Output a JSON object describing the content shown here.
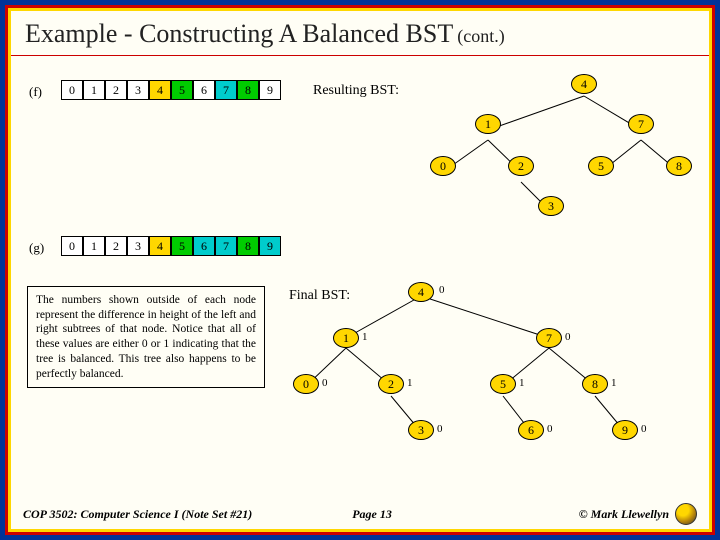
{
  "title": "Example - Constructing A Balanced BST",
  "title_cont": "(cont.)",
  "rows": {
    "f": {
      "label": "(f)",
      "cells": [
        "0",
        "1",
        "2",
        "3",
        "4",
        "5",
        "6",
        "7",
        "8",
        "9"
      ],
      "resulting_label": "Resulting BST:"
    },
    "g": {
      "label": "(g)",
      "cells": [
        "0",
        "1",
        "2",
        "3",
        "4",
        "5",
        "6",
        "7",
        "8",
        "9"
      ],
      "final_label": "Final BST:"
    }
  },
  "tree_f": {
    "n4": "4",
    "n1": "1",
    "n7": "7",
    "n0": "0",
    "n2": "2",
    "n5": "5",
    "n8": "8",
    "n3": "3"
  },
  "tree_g": {
    "n4": "4",
    "n1": "1",
    "n7": "7",
    "n0": "0",
    "n2": "2",
    "n5": "5",
    "n8": "8",
    "n3": "3",
    "n6": "6",
    "n9": "9",
    "bf4": "0",
    "bf1": "1",
    "bf7": "0",
    "bf0": "0",
    "bf2": "1",
    "bf5": "1",
    "bf8": "1",
    "bf3": "0",
    "bf6": "0",
    "bf9": "0"
  },
  "description": "The numbers shown outside of each node represent the difference in height of the left and right subtrees of that node. Notice that all of these values are either 0 or 1 indicating that the tree is balanced. This tree also happens to be perfectly balanced.",
  "footer": {
    "left": "COP 3502: Computer Science I (Note Set #21)",
    "mid": "Page 13",
    "right": "© Mark Llewellyn"
  }
}
